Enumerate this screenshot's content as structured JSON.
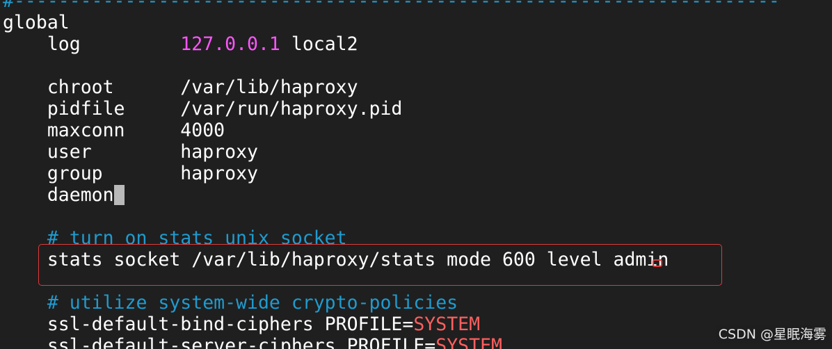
{
  "terminal": {
    "separator": "#---------------------------------------------------------------------",
    "section": "global",
    "log": {
      "key": "log",
      "address": "127.0.0.1",
      "facility": "local2"
    },
    "chroot": {
      "key": "chroot",
      "value": "/var/lib/haproxy"
    },
    "pidfile": {
      "key": "pidfile",
      "value": "/var/run/haproxy.pid"
    },
    "maxconn": {
      "key": "maxconn",
      "value": "4000"
    },
    "user": {
      "key": "user",
      "value": "haproxy"
    },
    "group": {
      "key": "group",
      "value": "haproxy"
    },
    "daemon": {
      "key": "daemon"
    },
    "comment_stats": "# turn on stats unix socket",
    "stats_socket": "stats socket /var/lib/haproxy/stats mode 600 level admin",
    "comment_crypto": "# utilize system-wide crypto-policies",
    "ssl_bind": {
      "key": "ssl-default-bind-ciphers",
      "prefix": "PROFILE=",
      "value": "SYSTEM"
    },
    "ssl_server": {
      "key": "ssl-default-server-ciphers",
      "prefix": "PROFILE=",
      "value": "SYSTEM"
    }
  },
  "watermark": "CSDN @星眠海雾",
  "colors": {
    "background": "#1f1f1f",
    "comment": "#1f9bcf",
    "number": "#ff55ff",
    "keyword": "#ff5f5f",
    "annotation": "#e03a3a"
  }
}
